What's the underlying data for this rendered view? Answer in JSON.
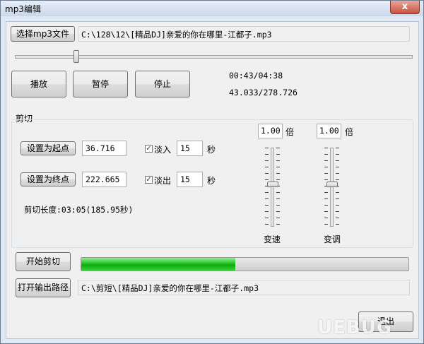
{
  "window": {
    "title": "mp3编辑",
    "close_symbol": "x"
  },
  "file": {
    "select_label": "选择mp3文件",
    "path": "C:\\128\\12\\[精品DJ]亲爱的你在哪里-江都子.mp3"
  },
  "position_slider": {
    "value_fraction": 0.155
  },
  "playback": {
    "play_label": "播放",
    "pause_label": "暂停",
    "stop_label": "停止",
    "time_display": "00:43/04:38",
    "seconds_display": "43.033/278.726"
  },
  "cut": {
    "group_label": "剪切",
    "set_start_label": "设置为起点",
    "start_value": "36.716",
    "fade_in_label": "淡入",
    "fade_in_checked": true,
    "fade_in_value": "15",
    "fade_in_unit": "秒",
    "set_end_label": "设置为终点",
    "end_value": "222.665",
    "fade_out_label": "淡出",
    "fade_out_checked": true,
    "fade_out_value": "15",
    "fade_out_unit": "秒",
    "length_text": "剪切长度:03:05(185.95秒)"
  },
  "speed": {
    "value": "1.00",
    "unit": "倍",
    "label": "变速",
    "level_fraction": 0.5
  },
  "pitch": {
    "value": "1.00",
    "unit": "倍",
    "label": "变调",
    "level_fraction": 0.5
  },
  "output": {
    "start_label": "开始剪切",
    "progress_fraction": 0.47,
    "open_label": "打开输出路径",
    "path": "C:\\剪短\\[精品DJ]亲爱的你在哪里-江都子.mp3"
  },
  "exit_label": "退出",
  "watermark": "UEBUG"
}
